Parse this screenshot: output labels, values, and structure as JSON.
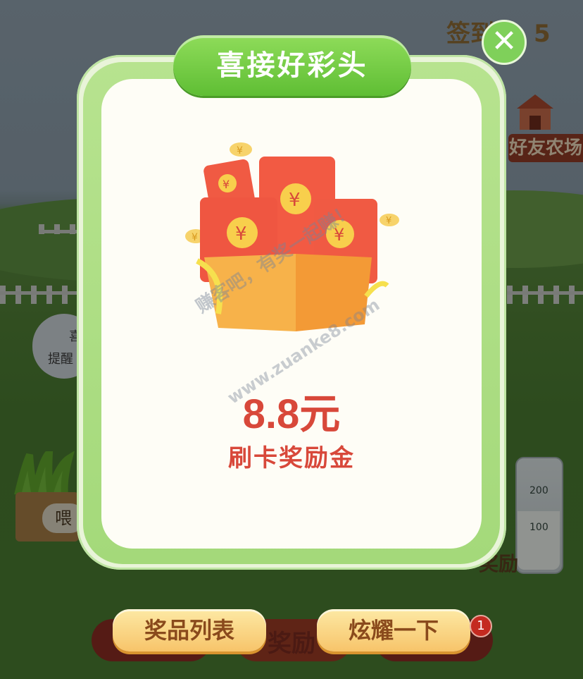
{
  "background": {
    "signin_text": "签到",
    "signin_count": "5",
    "friend_farm": "好友农场",
    "reminder_line1": "喜",
    "reminder_line2": "提醒",
    "feed_label": "喂",
    "bottle_200": "200",
    "bottle_100": "100",
    "reward_side": "奖励",
    "reward_bottom": "奖励"
  },
  "modal": {
    "title": "喜接好彩头",
    "close_glyph": "✕",
    "amount": "8.8元",
    "amount_label": "刷卡奖励金"
  },
  "watermark": {
    "line1": "赚客吧，有奖一起赚！",
    "line2": "www.zuanke8.com"
  },
  "actions": {
    "prize_list": "奖品列表",
    "show_off": "炫耀一下",
    "badge_count": "1"
  },
  "colors": {
    "accent_green": "#6cc63f",
    "amount_red": "#d8483a",
    "button_gold": "#f7c46a",
    "envelope_red": "#f25a43",
    "box_orange": "#f5a43a"
  }
}
